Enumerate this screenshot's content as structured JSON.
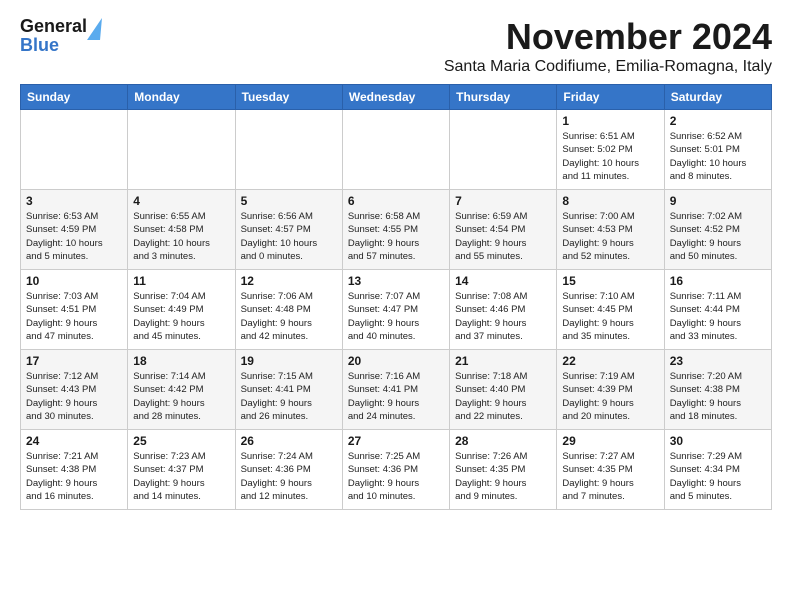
{
  "header": {
    "logo_line1": "General",
    "logo_line2": "Blue",
    "month": "November 2024",
    "location": "Santa Maria Codifiume, Emilia-Romagna, Italy"
  },
  "days_of_week": [
    "Sunday",
    "Monday",
    "Tuesday",
    "Wednesday",
    "Thursday",
    "Friday",
    "Saturday"
  ],
  "weeks": [
    [
      {
        "day": "",
        "info": ""
      },
      {
        "day": "",
        "info": ""
      },
      {
        "day": "",
        "info": ""
      },
      {
        "day": "",
        "info": ""
      },
      {
        "day": "",
        "info": ""
      },
      {
        "day": "1",
        "info": "Sunrise: 6:51 AM\nSunset: 5:02 PM\nDaylight: 10 hours\nand 11 minutes."
      },
      {
        "day": "2",
        "info": "Sunrise: 6:52 AM\nSunset: 5:01 PM\nDaylight: 10 hours\nand 8 minutes."
      }
    ],
    [
      {
        "day": "3",
        "info": "Sunrise: 6:53 AM\nSunset: 4:59 PM\nDaylight: 10 hours\nand 5 minutes."
      },
      {
        "day": "4",
        "info": "Sunrise: 6:55 AM\nSunset: 4:58 PM\nDaylight: 10 hours\nand 3 minutes."
      },
      {
        "day": "5",
        "info": "Sunrise: 6:56 AM\nSunset: 4:57 PM\nDaylight: 10 hours\nand 0 minutes."
      },
      {
        "day": "6",
        "info": "Sunrise: 6:58 AM\nSunset: 4:55 PM\nDaylight: 9 hours\nand 57 minutes."
      },
      {
        "day": "7",
        "info": "Sunrise: 6:59 AM\nSunset: 4:54 PM\nDaylight: 9 hours\nand 55 minutes."
      },
      {
        "day": "8",
        "info": "Sunrise: 7:00 AM\nSunset: 4:53 PM\nDaylight: 9 hours\nand 52 minutes."
      },
      {
        "day": "9",
        "info": "Sunrise: 7:02 AM\nSunset: 4:52 PM\nDaylight: 9 hours\nand 50 minutes."
      }
    ],
    [
      {
        "day": "10",
        "info": "Sunrise: 7:03 AM\nSunset: 4:51 PM\nDaylight: 9 hours\nand 47 minutes."
      },
      {
        "day": "11",
        "info": "Sunrise: 7:04 AM\nSunset: 4:49 PM\nDaylight: 9 hours\nand 45 minutes."
      },
      {
        "day": "12",
        "info": "Sunrise: 7:06 AM\nSunset: 4:48 PM\nDaylight: 9 hours\nand 42 minutes."
      },
      {
        "day": "13",
        "info": "Sunrise: 7:07 AM\nSunset: 4:47 PM\nDaylight: 9 hours\nand 40 minutes."
      },
      {
        "day": "14",
        "info": "Sunrise: 7:08 AM\nSunset: 4:46 PM\nDaylight: 9 hours\nand 37 minutes."
      },
      {
        "day": "15",
        "info": "Sunrise: 7:10 AM\nSunset: 4:45 PM\nDaylight: 9 hours\nand 35 minutes."
      },
      {
        "day": "16",
        "info": "Sunrise: 7:11 AM\nSunset: 4:44 PM\nDaylight: 9 hours\nand 33 minutes."
      }
    ],
    [
      {
        "day": "17",
        "info": "Sunrise: 7:12 AM\nSunset: 4:43 PM\nDaylight: 9 hours\nand 30 minutes."
      },
      {
        "day": "18",
        "info": "Sunrise: 7:14 AM\nSunset: 4:42 PM\nDaylight: 9 hours\nand 28 minutes."
      },
      {
        "day": "19",
        "info": "Sunrise: 7:15 AM\nSunset: 4:41 PM\nDaylight: 9 hours\nand 26 minutes."
      },
      {
        "day": "20",
        "info": "Sunrise: 7:16 AM\nSunset: 4:41 PM\nDaylight: 9 hours\nand 24 minutes."
      },
      {
        "day": "21",
        "info": "Sunrise: 7:18 AM\nSunset: 4:40 PM\nDaylight: 9 hours\nand 22 minutes."
      },
      {
        "day": "22",
        "info": "Sunrise: 7:19 AM\nSunset: 4:39 PM\nDaylight: 9 hours\nand 20 minutes."
      },
      {
        "day": "23",
        "info": "Sunrise: 7:20 AM\nSunset: 4:38 PM\nDaylight: 9 hours\nand 18 minutes."
      }
    ],
    [
      {
        "day": "24",
        "info": "Sunrise: 7:21 AM\nSunset: 4:38 PM\nDaylight: 9 hours\nand 16 minutes."
      },
      {
        "day": "25",
        "info": "Sunrise: 7:23 AM\nSunset: 4:37 PM\nDaylight: 9 hours\nand 14 minutes."
      },
      {
        "day": "26",
        "info": "Sunrise: 7:24 AM\nSunset: 4:36 PM\nDaylight: 9 hours\nand 12 minutes."
      },
      {
        "day": "27",
        "info": "Sunrise: 7:25 AM\nSunset: 4:36 PM\nDaylight: 9 hours\nand 10 minutes."
      },
      {
        "day": "28",
        "info": "Sunrise: 7:26 AM\nSunset: 4:35 PM\nDaylight: 9 hours\nand 9 minutes."
      },
      {
        "day": "29",
        "info": "Sunrise: 7:27 AM\nSunset: 4:35 PM\nDaylight: 9 hours\nand 7 minutes."
      },
      {
        "day": "30",
        "info": "Sunrise: 7:29 AM\nSunset: 4:34 PM\nDaylight: 9 hours\nand 5 minutes."
      }
    ]
  ]
}
